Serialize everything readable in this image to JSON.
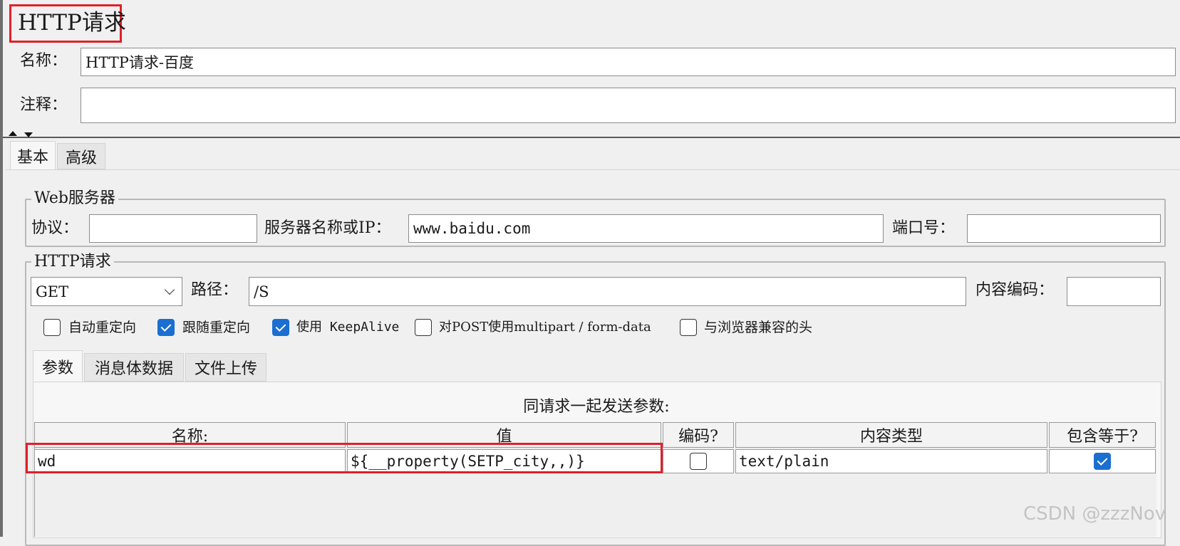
{
  "header": {
    "title": "HTTP请求"
  },
  "name_field": {
    "label": "名称：",
    "value": "HTTP请求-百度"
  },
  "comment_field": {
    "label": "注释：",
    "value": ""
  },
  "main_tabs": [
    {
      "label": "基本"
    },
    {
      "label": "高级"
    }
  ],
  "web_server": {
    "legend": "Web服务器",
    "protocol_label": "协议：",
    "protocol_value": "",
    "server_label": "服务器名称或IP：",
    "server_value": "www.baidu.com",
    "port_label": "端口号：",
    "port_value": ""
  },
  "http_request": {
    "legend": "HTTP请求",
    "method": "GET",
    "path_label": "路径：",
    "path_value": "/S",
    "encoding_label": "内容编码：",
    "encoding_value": ""
  },
  "options": [
    {
      "label": "自动重定向",
      "checked": false
    },
    {
      "label": "跟随重定向",
      "checked": true
    },
    {
      "label": "使用 KeepAlive",
      "checked": true
    },
    {
      "label": "对POST使用multipart / form-data",
      "checked": false
    },
    {
      "label": "与浏览器兼容的头",
      "checked": false
    }
  ],
  "sub_tabs": [
    {
      "label": "参数"
    },
    {
      "label": "消息体数据"
    },
    {
      "label": "文件上传"
    }
  ],
  "params": {
    "caption": "同请求一起发送参数:",
    "columns": [
      "名称:",
      "值",
      "编码?",
      "内容类型",
      "包含等于?"
    ],
    "rows": [
      {
        "name": "wd",
        "value": "${__property(SETP_city,,)}",
        "encode": false,
        "content_type": "text/plain",
        "include_equals": true
      }
    ]
  },
  "watermark": "CSDN @zzzNov",
  "colors": {
    "highlight": "#e0202a",
    "checkbox_checked": "#1a6fd0"
  }
}
